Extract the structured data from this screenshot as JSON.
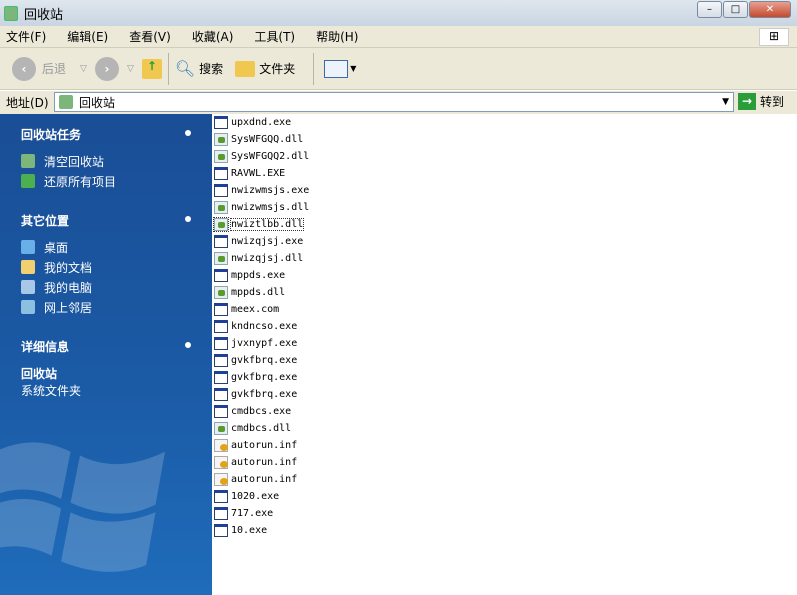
{
  "window": {
    "title": "回收站"
  },
  "menu": [
    "文件(F)",
    "编辑(E)",
    "查看(V)",
    "收藏(A)",
    "工具(T)",
    "帮助(H)"
  ],
  "toolbar": {
    "back": "后退",
    "search": "搜索",
    "folders": "文件夹"
  },
  "address": {
    "label": "地址(D)",
    "value": "回收站",
    "go": "转到"
  },
  "tasks": {
    "title": "回收站任务",
    "items": [
      "清空回收站",
      "还原所有项目"
    ]
  },
  "places": {
    "title": "其它位置",
    "items": [
      "桌面",
      "我的文档",
      "我的电脑",
      "网上邻居"
    ]
  },
  "details": {
    "title": "详细信息",
    "name": "回收站",
    "type": "系统文件夹"
  },
  "files": [
    {
      "name": "upxdnd.exe",
      "type": "exe"
    },
    {
      "name": "SysWFGQQ.dll",
      "type": "dll"
    },
    {
      "name": "SysWFGQQ2.dll",
      "type": "dll"
    },
    {
      "name": "RAVWL.EXE",
      "type": "exe"
    },
    {
      "name": "nwizwmsjs.exe",
      "type": "exe"
    },
    {
      "name": "nwizwmsjs.dll",
      "type": "dll"
    },
    {
      "name": "nwiztlbb.dll",
      "type": "dll"
    },
    {
      "name": "nwizqjsj.exe",
      "type": "exe"
    },
    {
      "name": "nwizqjsj.dll",
      "type": "dll"
    },
    {
      "name": "mppds.exe",
      "type": "exe"
    },
    {
      "name": "mppds.dll",
      "type": "dll"
    },
    {
      "name": "meex.com",
      "type": "exe"
    },
    {
      "name": "kndncso.exe",
      "type": "exe"
    },
    {
      "name": "jvxnypf.exe",
      "type": "exe"
    },
    {
      "name": "gvkfbrq.exe",
      "type": "exe"
    },
    {
      "name": "gvkfbrq.exe",
      "type": "exe"
    },
    {
      "name": "gvkfbrq.exe",
      "type": "exe"
    },
    {
      "name": "cmdbcs.exe",
      "type": "exe"
    },
    {
      "name": "cmdbcs.dll",
      "type": "dll"
    },
    {
      "name": "autorun.inf",
      "type": "inf"
    },
    {
      "name": "autorun.inf",
      "type": "inf"
    },
    {
      "name": "autorun.inf",
      "type": "inf"
    },
    {
      "name": "1020.exe",
      "type": "exe"
    },
    {
      "name": "717.exe",
      "type": "exe"
    },
    {
      "name": "10.exe",
      "type": "exe"
    }
  ]
}
